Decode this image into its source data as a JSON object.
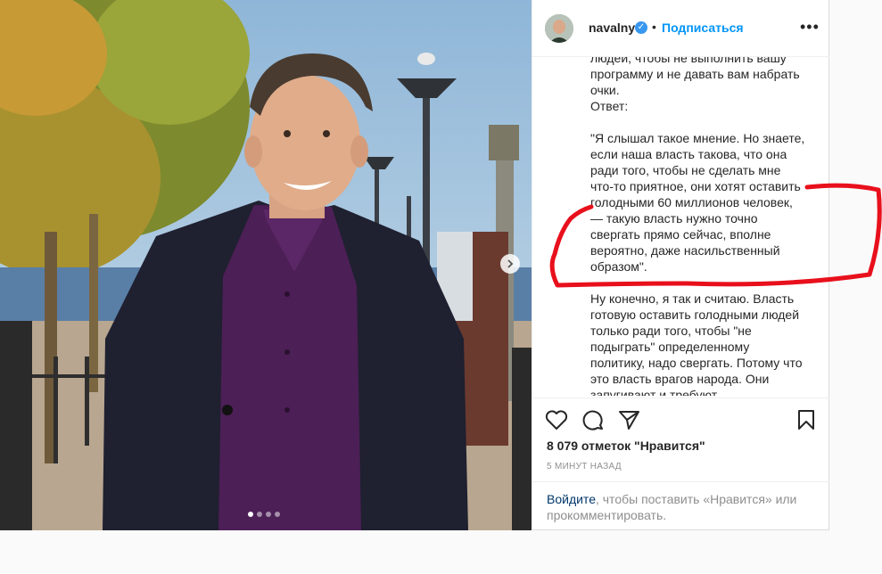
{
  "header": {
    "username": "navalny",
    "separator": "•",
    "follow_label": "Подписаться",
    "more_icon": "ellipsis-icon"
  },
  "caption": {
    "text": "людей, чтобы не выполнить вашу\nпрограмму и не давать вам набрать\nочки.\nОтвет:\n\n\"Я слышал такое мнение. Но знаете,\nесли наша власть такова, что она\nради того, чтобы не сделать мне\nчто-то приятное, они хотят оставить\nголодными 60 миллионов человек,\n— такую власть нужно точно\nсвергать прямо сейчас, вполне\nвероятно, даже насильственный\nобразом\".\n\nНу конечно, я так и считаю. Власть\nготовую оставить голодными людей\nтолько ради того, чтобы \"не\nподыграть\" определенному\nполитику, надо свергать. Потому что\nэто власть врагов народа. Они\nзапугивают и требуют"
  },
  "actions": {
    "like_icon": "heart-icon",
    "comment_icon": "comment-icon",
    "share_icon": "paper-plane-icon",
    "save_icon": "bookmark-icon",
    "likes_text": "8 079 отметок \"Нравится\"",
    "timestamp": "5 МИНУТ НАЗАД"
  },
  "login_prompt": {
    "link": "Войдите",
    "rest": ", чтобы поставить «Нравится» или прокомментировать."
  },
  "carousel": {
    "dot_count": 4,
    "active_index": 0
  },
  "colors": {
    "accent": "#0095f6",
    "annotation": "#e8101c"
  }
}
